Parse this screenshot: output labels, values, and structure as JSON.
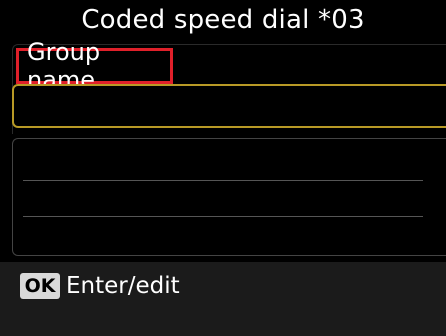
{
  "screen": {
    "title": "Coded speed dial *03"
  },
  "group_name": {
    "label": "Group name",
    "value": ""
  },
  "members": [
    {
      "value": ""
    },
    {
      "value": ""
    },
    {
      "value": ""
    }
  ],
  "footer": {
    "ok_key_label": "OK",
    "hint_label": "Enter/edit"
  },
  "colors": {
    "highlight_border": "#e0202a",
    "selected_field_border": "#b89a26"
  }
}
